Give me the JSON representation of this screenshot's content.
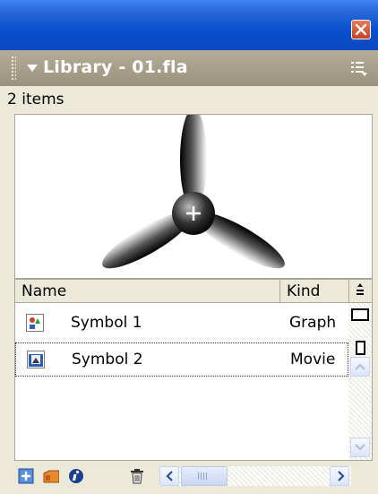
{
  "panel": {
    "title": "Library - 01.fla",
    "item_count_text": "2 items"
  },
  "columns": {
    "name": "Name",
    "kind": "Kind"
  },
  "items": [
    {
      "name": "Symbol 1",
      "kind": "Graph",
      "icon": "graphic-symbol-icon",
      "selected": false
    },
    {
      "name": "Symbol 2",
      "kind": "Movie",
      "icon": "movie-clip-symbol-icon",
      "selected": true
    }
  ],
  "colors": {
    "titlebar": "#0a4fce",
    "panel_header": "#a8a08a",
    "close_button": "#d45a32"
  }
}
